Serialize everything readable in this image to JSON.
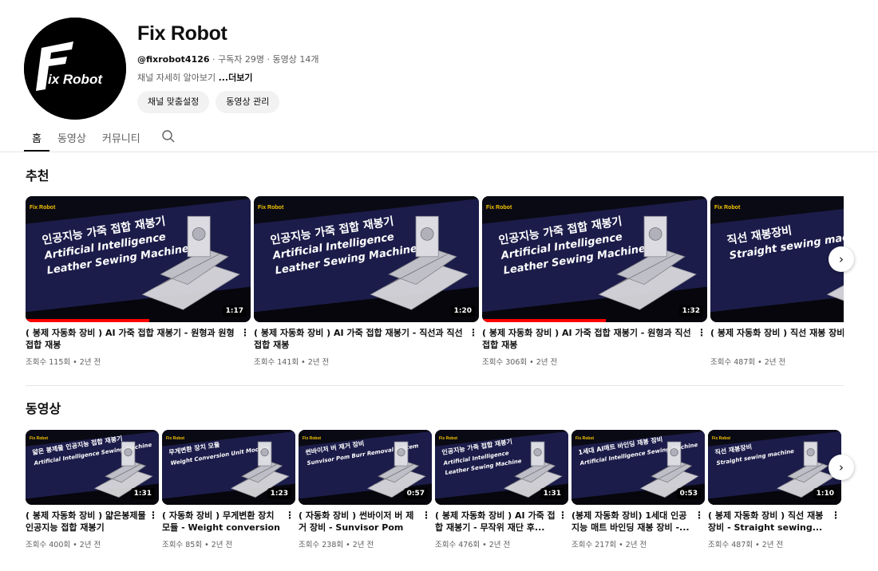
{
  "channel": {
    "name": "Fix Robot",
    "handle": "@fixrobot4126",
    "meta": " · 구독자 29명 · 동영상 14개",
    "desc": "채널 자세히 알아보기 ",
    "more": "...더보기",
    "logo_text": "ix Robot",
    "buttons": [
      "채널 맞춤설정",
      "동영상 관리"
    ]
  },
  "tabs": [
    "홈",
    "동영상",
    "커뮤니티"
  ],
  "sections": {
    "recommended": {
      "title": "추천",
      "videos": [
        {
          "title": "( 봉제 자동화 장비 ) AI 가죽 접합 재봉기 - 원형과 원형 접합 재봉",
          "meta": "조회수 115회 • 2년 전",
          "duration": "1:17",
          "thumb_lines": [
            "인공지능 가죽 접합 재봉기",
            "Artificial Intelligence",
            "Leather Sewing Machine"
          ]
        },
        {
          "title": "( 봉제 자동화 장비 ) AI 가죽 접합 재봉기 - 직선과 직선 접합 재봉",
          "meta": "조회수 141회 • 2년 전",
          "duration": "1:20",
          "thumb_lines": [
            "인공지능 가죽 접합 재봉기",
            "Artificial Intelligence",
            "Leather Sewing Machine"
          ]
        },
        {
          "title": "( 봉제 자동화 장비 ) AI 가죽 접합 재봉기 - 원형과 직선 접합 재봉",
          "meta": "조회수 306회 • 2년 전",
          "duration": "1:32",
          "thumb_lines": [
            "인공지능 가죽 접합 재봉기",
            "Artificial Intelligence",
            "Leather Sewing Machine"
          ]
        },
        {
          "title": "( 봉제 자동화 장비 ) 직선 재봉 장비 machine",
          "meta": "조회수 487회 • 2년 전",
          "duration": "",
          "thumb_lines": [
            "직선 재봉장비",
            "Straight sewing machine",
            ""
          ]
        }
      ]
    },
    "videos": {
      "title": "동영상",
      "videos": [
        {
          "title": "( 봉제 자동화 장비 ) 얇은봉제물 인공지능 접합 재봉기",
          "meta": "조회수 400회 • 2년 전",
          "duration": "1:31",
          "thumb_lines": [
            "얇은 봉제물 인공지능 접합 재봉기",
            "Artificial Intelligence Sewing Machine",
            ""
          ]
        },
        {
          "title": "( 자동화 장비 ) 무게변환 장치 모듈 - Weight conversion un...",
          "meta": "조회수 85회 • 2년 전",
          "duration": "1:23",
          "thumb_lines": [
            "무게변환 장치 모듈",
            "Weight Conversion Unit Module",
            ""
          ]
        },
        {
          "title": "( 자동화 장비 ) 썬바이저 버 제거 장비 - Sunvisor Pom Burr...",
          "meta": "조회수 238회 • 2년 전",
          "duration": "0:57",
          "thumb_lines": [
            "썬바이저 버 제거 장비",
            "Sunvisor Pom Burr Removal System",
            ""
          ]
        },
        {
          "title": "( 봉제 자동화 장비 ) AI 가죽 접합 재봉기 - 무작위 재단 후...",
          "meta": "조회수 476회 • 2년 전",
          "duration": "1:31",
          "thumb_lines": [
            "인공지능 가죽 접합 재봉기",
            "Artificial Intelligence",
            "Leather Sewing Machine"
          ]
        },
        {
          "title": "(봉제 자동화 장비) 1세대 인공지능 매트 바인딩 재봉 장비 -...",
          "meta": "조회수 217회 • 2년 전",
          "duration": "0:53",
          "thumb_lines": [
            "1세대 AI매트 바인딩 재봉 장비",
            "Artificial Intelligence Sewing Machine",
            ""
          ]
        },
        {
          "title": "( 봉제 자동화 장비 ) 직선 재봉 장비 - Straight sewing...",
          "meta": "조회수 487회 • 2년 전",
          "duration": "1:10",
          "thumb_lines": [
            "직선 재봉장비",
            "Straight sewing machine",
            ""
          ]
        }
      ]
    }
  },
  "thumb_logo": "Fix Robot",
  "colors": {
    "thumb_bg": "#1c1c4a",
    "thumb_dark": "#0a0a14",
    "progress": "#ff0000",
    "meta": "#606060"
  },
  "icons": {
    "search": "search-icon",
    "next": "chevron-right-icon",
    "more": "more-vert-icon"
  }
}
